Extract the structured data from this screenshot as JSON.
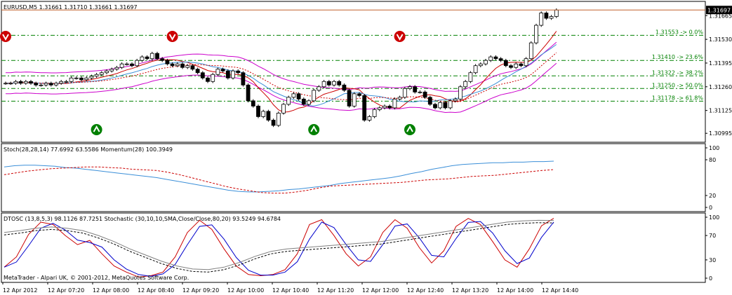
{
  "window": {
    "header": "EURUSD,M5  1.31661 1.31710 1.31661 1.31697",
    "copyright": "MetaTrader - Alpari UK, © 2001-2012, MetaQuotes Software Corp.",
    "current_price": "1.31697"
  },
  "colors": {
    "background": "#ffffff",
    "axis": "#000000",
    "candle_up": "#ffffff",
    "candle_down": "#000000",
    "bollinger": "#cc00cc",
    "ma_red": "#cc0000",
    "ma_blue": "#3b8fd8",
    "fibo": "#008000",
    "bid_line": "#c0602b",
    "fractal_up": "#008000",
    "fractal_down": "#cc0000",
    "stoch_line": "#3b8fd8",
    "momentum_line": "#cc0000",
    "dtosc_fast": "#cc0000",
    "dtosc_slow": "#0000cc",
    "stoch2_main": "#808080",
    "stoch2_signal": "#000000",
    "highlight_green": "#00cc00",
    "highlight_red": "#cc0000"
  },
  "price_axis": {
    "ticks": [
      "1.31665",
      "1.31530",
      "1.31395",
      "1.31260",
      "1.31125",
      "1.30995"
    ],
    "range": [
      1.3096,
      1.3173
    ]
  },
  "time_axis": {
    "labels": [
      "12 Apr 2012",
      "12 Apr 07:20",
      "12 Apr 08:00",
      "12 Apr 08:40",
      "12 Apr 09:20",
      "12 Apr 10:00",
      "12 Apr 10:40",
      "12 Apr 11:20",
      "12 Apr 12:00",
      "12 Apr 12:40",
      "12 Apr 13:20",
      "12 Apr 14:00",
      "12 Apr 14:40"
    ]
  },
  "fibo_levels": [
    {
      "label": "1.31553 -> 0.0%",
      "price": 1.31553
    },
    {
      "label": "1.31410 -> 23.6%",
      "price": 1.3141
    },
    {
      "label": "1.31322 -> 38.2%",
      "price": 1.31322
    },
    {
      "label": "1.31250 -> 50.0%",
      "price": 1.3125
    },
    {
      "label": "1.31178 -> 61.8%",
      "price": 1.31178
    }
  ],
  "panel2": {
    "header": "Stoch(28,28,14) 77.6992 63.5586  Momentum(28) 100.3949",
    "ticks": [
      "100",
      "80",
      "20",
      "0"
    ]
  },
  "panel3": {
    "header": "DTOSC (13,8,5,3) 98.1126 87.7251  Stochastic (30,10,10,SMA,Close/Close,80,20) 93.5249 94.6784",
    "ticks": [
      "100",
      "70",
      "30",
      "0"
    ]
  },
  "chart_data": [
    {
      "type": "candlestick",
      "symbol": "EURUSD",
      "timeframe": "M5",
      "ohlc_last": {
        "open": 1.31661,
        "high": 1.3171,
        "low": 1.31661,
        "close": 1.31697
      },
      "closes": [
        1.3128,
        1.3128,
        1.3129,
        1.3128,
        1.3129,
        1.3128,
        1.3127,
        1.3127,
        1.3128,
        1.3127,
        1.3128,
        1.3129,
        1.3129,
        1.3131,
        1.3131,
        1.313,
        1.3131,
        1.3132,
        1.3133,
        1.3134,
        1.3135,
        1.3136,
        1.3137,
        1.3139,
        1.3139,
        1.3138,
        1.3141,
        1.3143,
        1.3142,
        1.3145,
        1.3142,
        1.3141,
        1.3139,
        1.3138,
        1.3139,
        1.3137,
        1.3138,
        1.3136,
        1.3134,
        1.3131,
        1.3129,
        1.3133,
        1.3136,
        1.3135,
        1.3131,
        1.3135,
        1.3134,
        1.3127,
        1.3118,
        1.3115,
        1.3109,
        1.3112,
        1.3107,
        1.3104,
        1.3111,
        1.3116,
        1.312,
        1.3122,
        1.3119,
        1.3116,
        1.3118,
        1.3124,
        1.3126,
        1.3129,
        1.3127,
        1.3129,
        1.3127,
        1.3124,
        1.3115,
        1.3122,
        1.3121,
        1.3107,
        1.3109,
        1.3113,
        1.3114,
        1.3115,
        1.3114,
        1.3119,
        1.312,
        1.3125,
        1.3126,
        1.3123,
        1.3123,
        1.312,
        1.3116,
        1.3114,
        1.3117,
        1.3114,
        1.3118,
        1.3119,
        1.3126,
        1.3129,
        1.3134,
        1.3138,
        1.3139,
        1.3141,
        1.3143,
        1.3142,
        1.3141,
        1.3138,
        1.3137,
        1.3139,
        1.3138,
        1.3142,
        1.3151,
        1.3161,
        1.3168,
        1.3165,
        1.3166,
        1.31697
      ]
    },
    {
      "type": "line",
      "title": "Stoch(28,28,14)",
      "values_shown": [
        77.6992,
        63.5586
      ],
      "ylim": [
        0,
        100
      ],
      "series": [
        {
          "name": "Stoch(28,28,14)",
          "values": [
            68,
            70,
            71,
            71,
            70,
            69,
            67,
            66,
            64,
            62,
            60,
            58,
            56,
            54,
            52,
            50,
            47,
            44,
            41,
            38,
            35,
            32,
            29,
            27,
            26,
            26,
            27,
            28,
            30,
            31,
            33,
            35,
            37,
            40,
            42,
            44,
            46,
            48,
            50,
            53,
            57,
            60,
            64,
            67,
            70,
            72,
            73,
            74,
            75,
            75,
            76,
            76,
            77,
            77,
            77.7
          ]
        },
        {
          "name": "Momentum(28)",
          "values": [
            55,
            58,
            61,
            63,
            65,
            66,
            67,
            68,
            68,
            67,
            66,
            64,
            63,
            62,
            59,
            55,
            50,
            45,
            40,
            35,
            31,
            28,
            25,
            24,
            24,
            26,
            29,
            33,
            36,
            37,
            38,
            39,
            40,
            41,
            42,
            44,
            46,
            47,
            48,
            50,
            52,
            53,
            54,
            56,
            58,
            60,
            62,
            63.56
          ]
        }
      ]
    },
    {
      "type": "line",
      "title": "DTOSC (13,8,5,3)",
      "values_shown": [
        98.1126,
        87.7251,
        93.5249,
        94.6784
      ],
      "ylim": [
        0,
        100
      ],
      "series": [
        {
          "name": "DTOSC (13,8,5,3)",
          "values": [
            18,
            35,
            72,
            92,
            88,
            70,
            55,
            62,
            40,
            20,
            10,
            2,
            4,
            10,
            35,
            75,
            95,
            80,
            48,
            20,
            6,
            4,
            6,
            14,
            40,
            88,
            96,
            70,
            40,
            20,
            35,
            75,
            96,
            82,
            50,
            25,
            45,
            85,
            98,
            88,
            60,
            30,
            18,
            48,
            86,
            98.11
          ]
        },
        {
          "name": "Stochastic (30,10,10,SMA,Close/Close,80,20)",
          "values": [
            75,
            78,
            82,
            84,
            82,
            78,
            70,
            60,
            48,
            38,
            28,
            20,
            15,
            14,
            18,
            26,
            36,
            44,
            48,
            50,
            52,
            54,
            56,
            58,
            60,
            64,
            68,
            72,
            76,
            80,
            84,
            88,
            92,
            94,
            95,
            94.68
          ]
        }
      ]
    }
  ]
}
